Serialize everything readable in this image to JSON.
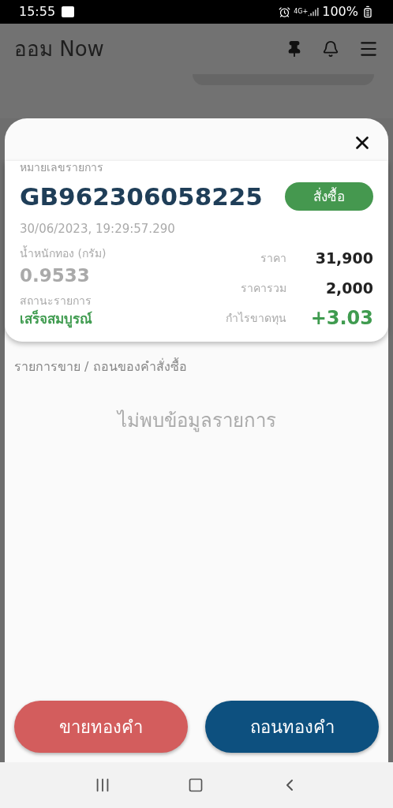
{
  "status_bar": {
    "time": "15:55",
    "network": "4G+",
    "battery": "100%"
  },
  "app_bar": {
    "title": "ออม Now"
  },
  "order": {
    "id_label": "หมายเลขรายการ",
    "id": "GB962306058225",
    "badge": "สั่งซื้อ",
    "timestamp": "30/06/2023, 19:29:57.290",
    "weight_label": "น้ำหนักทอง (กรัม)",
    "weight": "0.9533",
    "status_label": "สถานะรายการ",
    "status": "เสร็จสมบูรณ์",
    "details": [
      {
        "label": "ราคา",
        "value": "31,900",
        "kind": "plain"
      },
      {
        "label": "ราคารวม",
        "value": "2,000",
        "kind": "plain"
      },
      {
        "label": "กำไรขาดทุน",
        "value": "+3.03",
        "kind": "gain"
      }
    ]
  },
  "section_title": "รายการขาย / ถอนของคำสั่งซื้อ",
  "empty_message": "ไม่พบข้อมูลรายการ",
  "actions": [
    {
      "label": "ขายทองคำ",
      "kind": "sell"
    },
    {
      "label": "ถอนทองคำ",
      "kind": "withdraw"
    }
  ]
}
